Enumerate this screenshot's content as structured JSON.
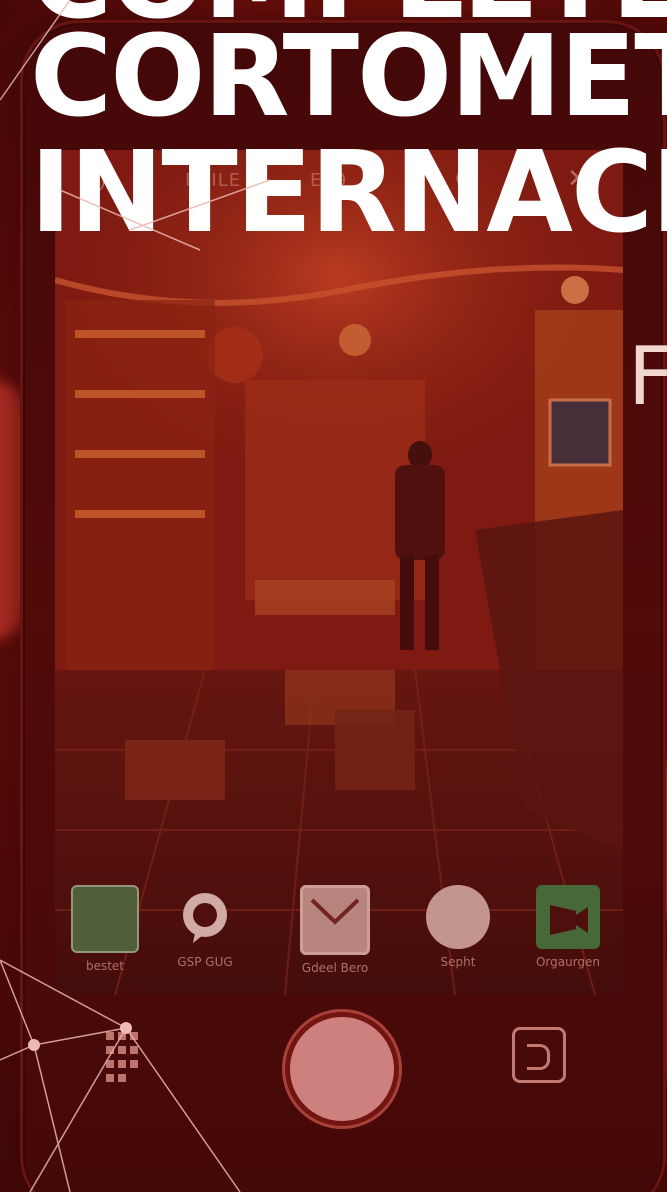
{
  "headline": {
    "line1": "COMPLETE",
    "line2": "CORTOMET",
    "line3": "INTERNACIO",
    "partial_letter": "F"
  },
  "camera_ui": {
    "top_labels": [
      "PHILE",
      "E89"
    ],
    "apps": [
      {
        "label": "bestet",
        "icon": "green-app-icon",
        "color": "#3c7a4b"
      },
      {
        "label": "GSP GUG",
        "icon": "chat-bubble-icon",
        "color": "#efe3df"
      },
      {
        "label": "Gdeel Bero",
        "icon": "mail-icon",
        "color": "#c9b0a8"
      },
      {
        "label": "Sepht",
        "icon": "globe-icon",
        "color": "#d8c7c1"
      },
      {
        "label": "Orgaurgen",
        "icon": "video-app-icon",
        "color": "#2f8a4a"
      }
    ]
  },
  "colors": {
    "overlay": "#8a1510",
    "shutter": "#e8a9a9",
    "text": "#ffffff"
  }
}
